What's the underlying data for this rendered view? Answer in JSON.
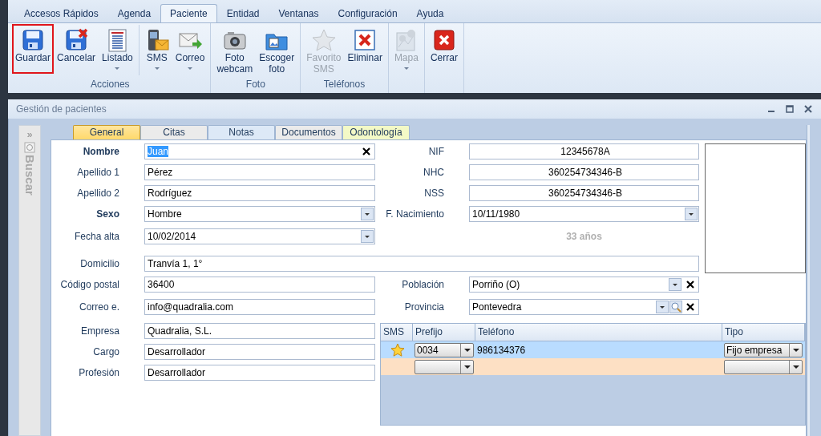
{
  "menu_tabs": [
    {
      "label": "Accesos Rápidos",
      "selected": false
    },
    {
      "label": "Agenda",
      "selected": false
    },
    {
      "label": "Paciente",
      "selected": true
    },
    {
      "label": "Entidad",
      "selected": false
    },
    {
      "label": "Ventanas",
      "selected": false
    },
    {
      "label": "Configuración",
      "selected": false
    },
    {
      "label": "Ayuda",
      "selected": false
    }
  ],
  "ribbon": {
    "groups": [
      {
        "label": "Acciones",
        "buttons": [
          {
            "label": "Guardar",
            "kind": "save",
            "highlighted": true,
            "disabled": false,
            "dropdown": false
          },
          {
            "label": "Cancelar",
            "kind": "cancel",
            "highlighted": false,
            "disabled": false,
            "dropdown": false
          },
          {
            "label": "Listado",
            "kind": "list",
            "highlighted": false,
            "disabled": false,
            "dropdown": true
          },
          {
            "label": "SMS",
            "kind": "sms",
            "highlighted": false,
            "disabled": false,
            "dropdown": true,
            "separator_before": true
          },
          {
            "label": "Correo",
            "kind": "mail",
            "highlighted": false,
            "disabled": false,
            "dropdown": true
          }
        ]
      },
      {
        "label": "Foto",
        "buttons": [
          {
            "label": "Foto\nwebcam",
            "kind": "camera",
            "highlighted": false,
            "disabled": false,
            "dropdown": false
          },
          {
            "label": "Escoger\nfoto",
            "kind": "folder",
            "highlighted": false,
            "disabled": false,
            "dropdown": false
          }
        ]
      },
      {
        "label": "Teléfonos",
        "buttons": [
          {
            "label": "Favorito\nSMS",
            "kind": "star",
            "highlighted": false,
            "disabled": true,
            "dropdown": false
          },
          {
            "label": "Eliminar",
            "kind": "delete",
            "highlighted": false,
            "disabled": false,
            "dropdown": false
          }
        ]
      },
      {
        "buttons": [
          {
            "label": "Mapa",
            "kind": "map",
            "highlighted": false,
            "disabled": true,
            "dropdown": true
          }
        ]
      },
      {
        "buttons": [
          {
            "label": "Cerrar",
            "kind": "close",
            "highlighted": false,
            "disabled": false,
            "dropdown": false
          }
        ]
      }
    ]
  },
  "window": {
    "title": "Gestión de pacientes"
  },
  "sidebar": {
    "expand_glyph": "»",
    "label": "Buscar"
  },
  "tabs": [
    {
      "label": "General",
      "selected": true,
      "color": "#ffd96b"
    },
    {
      "label": "Citas",
      "selected": false,
      "color": "#ebebeb"
    },
    {
      "label": "Notas",
      "selected": false,
      "color": "#dde9f7"
    },
    {
      "label": "Documentos",
      "selected": false,
      "color": "#ebebeb"
    },
    {
      "label": "Odontología",
      "selected": false,
      "color": "#f3f9c6"
    }
  ],
  "form": {
    "rows": [
      {
        "left": {
          "label": "Nombre",
          "value": "Juan",
          "kind": "clear",
          "bold": true,
          "value_selected": true
        },
        "right": {
          "label": "NIF",
          "value": "12345678A",
          "kind": "centered"
        }
      },
      {
        "left": {
          "label": "Apellido 1",
          "value": "Pérez",
          "kind": "text"
        },
        "right": {
          "label": "NHC",
          "value": "360254734346-B",
          "kind": "centered"
        }
      },
      {
        "left": {
          "label": "Apellido 2",
          "value": "Rodríguez",
          "kind": "text"
        },
        "right": {
          "label": "NSS",
          "value": "360254734346-B",
          "kind": "centered"
        }
      },
      {
        "left": {
          "label": "Sexo",
          "value": "Hombre",
          "kind": "dropdown",
          "bold": true
        },
        "right": {
          "label": "F. Nacimiento",
          "value": "10/11/1980",
          "kind": "dropdown"
        }
      },
      {
        "left": {
          "label": "Fecha alta",
          "value": "10/02/2014",
          "kind": "dropdown"
        },
        "right": {
          "value": "33 años",
          "kind": "note"
        }
      },
      {
        "left": {
          "label": "Domicilio",
          "value": "Tranvía 1, 1°",
          "kind": "wide"
        }
      },
      {
        "left": {
          "label": "Código postal",
          "value": "36400",
          "kind": "text"
        },
        "right": {
          "label": "Población",
          "value": "Porriño (O)",
          "kind": "dropdown-clear"
        }
      },
      {
        "left": {
          "label": "Correo e.",
          "value": "info@quadralia.com",
          "kind": "text"
        },
        "right": {
          "label": "Provincia",
          "value": "Pontevedra",
          "kind": "lookup"
        }
      },
      {
        "left": {
          "label": "Empresa",
          "value": "Quadralia, S.L.",
          "kind": "text"
        }
      },
      {
        "left": {
          "label": "Cargo",
          "value": "Desarrollador",
          "kind": "text"
        }
      },
      {
        "left": {
          "label": "Profesión",
          "value": "Desarrollador",
          "kind": "text"
        }
      }
    ]
  },
  "phones": {
    "columns": [
      "SMS",
      "Prefijo",
      "Teléfono",
      "Tipo"
    ],
    "rows": [
      {
        "favorite": true,
        "selected": true,
        "prefix": "0034",
        "phone": "986134376",
        "type": "Fijo empresa"
      },
      {
        "new_row": true,
        "favorite": false,
        "selected": false
      }
    ]
  }
}
